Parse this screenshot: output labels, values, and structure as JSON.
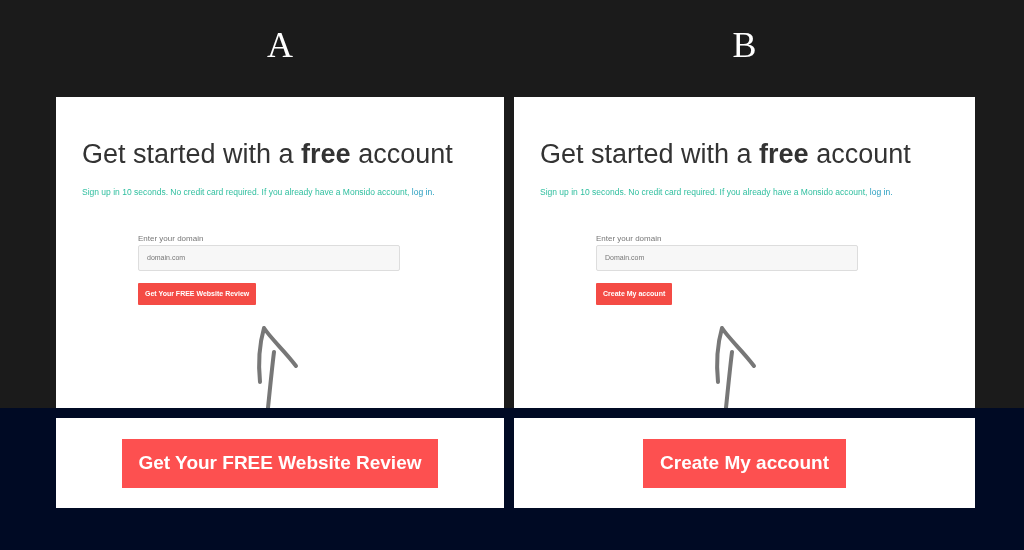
{
  "variants": [
    {
      "letter": "A",
      "screenshot": {
        "title": "Get started with a **free** account",
        "subtitle": "Sign up in 10 seconds. No credit card required. If you already have a Monsido account,",
        "login_link": "log in.",
        "field_label": "Enter your domain",
        "placeholder": "domain.com",
        "button": "Get Your FREE Website Review"
      },
      "cta": "Get Your FREE Website Review"
    },
    {
      "letter": "B",
      "screenshot": {
        "title": "Get started with a **free** account",
        "subtitle": "Sign up in 10 seconds. No credit card required. If you already have a Monsido account,",
        "login_link": "log in.",
        "field_label": "Enter your domain",
        "placeholder": "Domain.com",
        "button": "Create My account"
      },
      "cta": "Create My account"
    }
  ]
}
